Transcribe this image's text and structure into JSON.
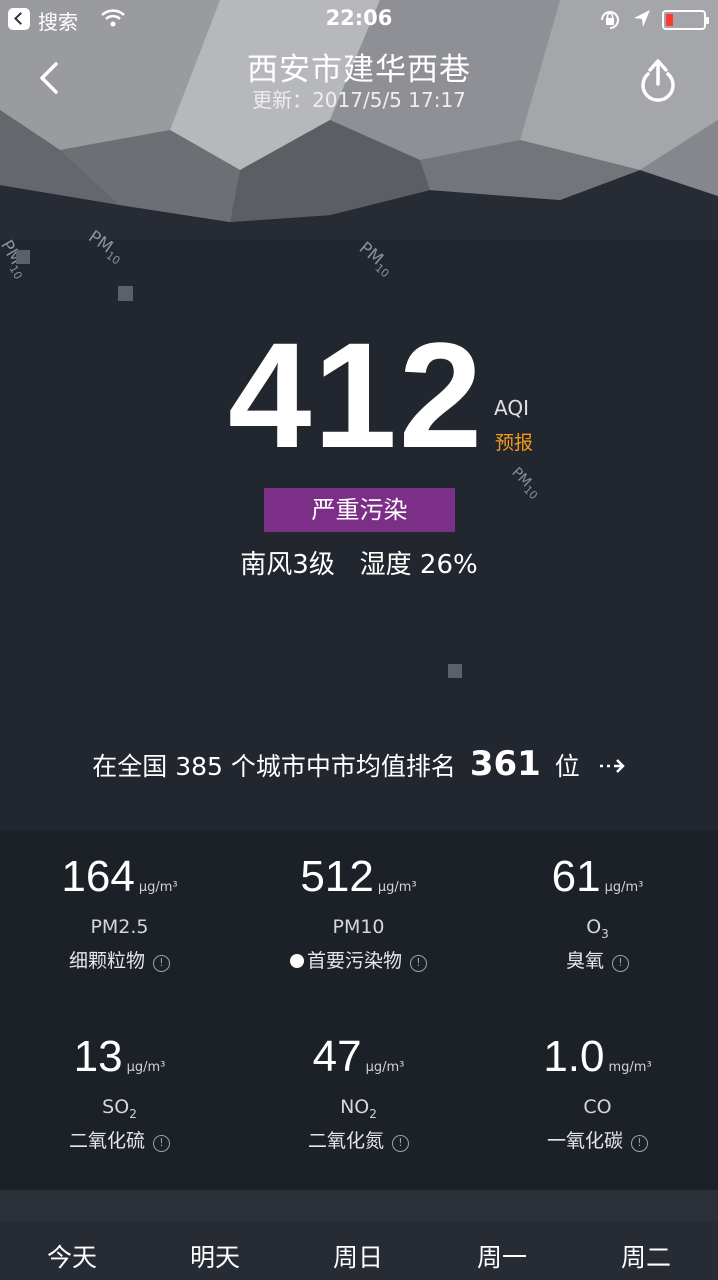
{
  "status_bar": {
    "app_label": "搜索",
    "time": "22:06",
    "battery_level": 0.2,
    "battery_color": "#ff3b30"
  },
  "header": {
    "title": "西安市建华西巷",
    "updated": "更新：2017/5/5 17:17",
    "back_icon": "chevron-left-icon",
    "share_icon": "share-icon"
  },
  "floating_labels": {
    "text": "PM",
    "sub": "10"
  },
  "aqi": {
    "value": "412",
    "label": "AQI",
    "forecast": "预报",
    "level": "严重污染",
    "level_color": "#7b2f86",
    "wind": "南风3级",
    "humidity": "湿度 26%"
  },
  "ranking": {
    "prefix": "在全国 385 个城市中市均值排名",
    "rank": "361",
    "suffix": "位"
  },
  "pollutants": [
    {
      "value": "164",
      "unit": "μg/m³",
      "code": "PM2.5",
      "code_sub": "",
      "name": "细颗粒物",
      "primary": false
    },
    {
      "value": "512",
      "unit": "μg/m³",
      "code": "PM10",
      "code_sub": "",
      "name": "首要污染物",
      "primary": true
    },
    {
      "value": "61",
      "unit": "μg/m³",
      "code": "O",
      "code_sub": "3",
      "name": "臭氧",
      "primary": false
    },
    {
      "value": "13",
      "unit": "μg/m³",
      "code": "SO",
      "code_sub": "2",
      "name": "二氧化硫",
      "primary": false
    },
    {
      "value": "47",
      "unit": "μg/m³",
      "code": "NO",
      "code_sub": "2",
      "name": "二氧化氮",
      "primary": false
    },
    {
      "value": "1.0",
      "unit": "mg/m³",
      "code": "CO",
      "code_sub": "",
      "name": "一氧化碳",
      "primary": false
    }
  ],
  "tabs": [
    "今天",
    "明天",
    "周日",
    "周一",
    "周二"
  ]
}
